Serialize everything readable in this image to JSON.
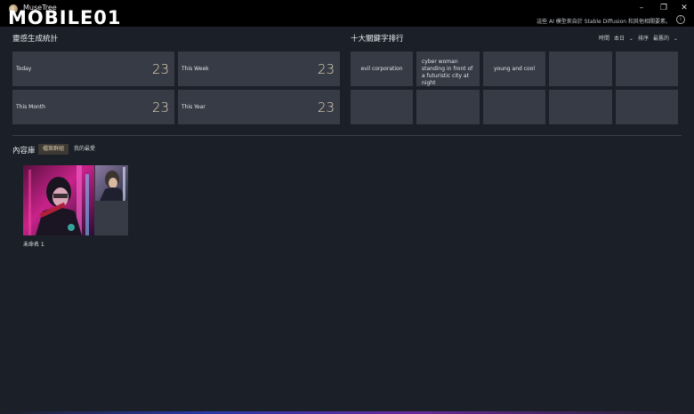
{
  "window": {
    "app_title": "MuseTree",
    "minimize": "–",
    "maximize": "❐",
    "close": "✕"
  },
  "watermark": {
    "text": "MOBILE01"
  },
  "notice": {
    "text": "這些 AI 模型來自於 Stable Diffusion 和其他相關要素。",
    "info_icon": "i"
  },
  "stats": {
    "title": "靈感生成統計",
    "items": [
      {
        "label": "Today",
        "value": "23"
      },
      {
        "label": "This Week",
        "value": "23"
      },
      {
        "label": "This Month",
        "value": "23"
      },
      {
        "label": "This Year",
        "value": "23"
      }
    ]
  },
  "keywords": {
    "title": "十大關鍵字排行",
    "time_label": "時間",
    "time_value": "本日",
    "sort_label": "排序",
    "sort_value": "最舊的",
    "items": [
      "evil corporation",
      "cyber woman standing in front of a futuristic city at night",
      "young and cool",
      "",
      "",
      "",
      "",
      "",
      "",
      ""
    ]
  },
  "library": {
    "title": "內容庫",
    "tabs": [
      "檔案群組",
      "我的最愛"
    ],
    "albums": [
      {
        "name": "未命名 1"
      }
    ]
  },
  "colors": {
    "background": "#1b1f27",
    "tile": "#363b45",
    "accent": "#e6d6b9"
  }
}
